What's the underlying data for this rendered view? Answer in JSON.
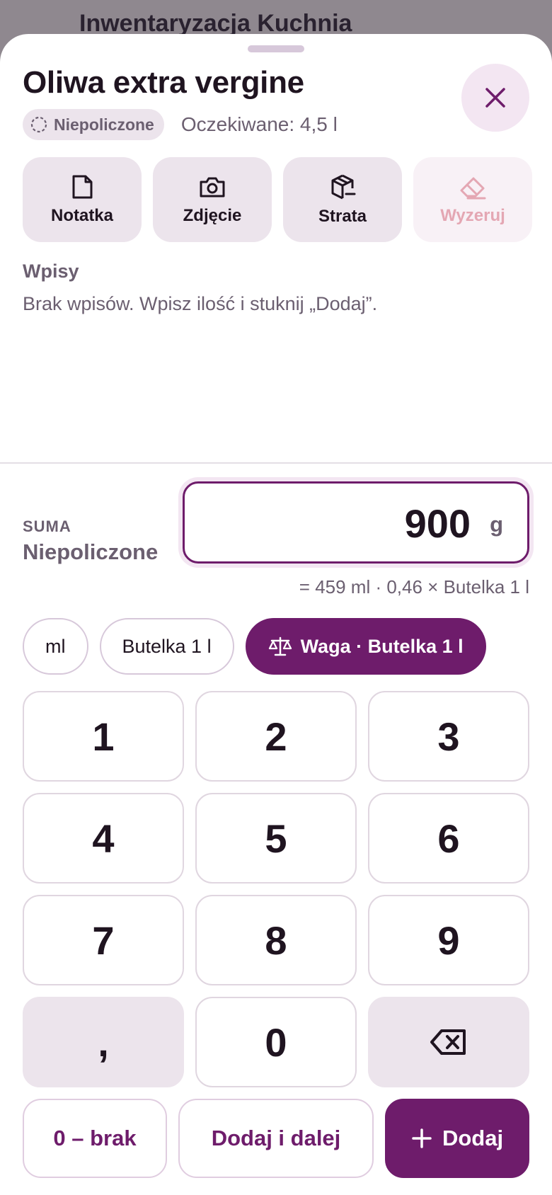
{
  "background": {
    "title": "Inwentaryzacja Kuchnia"
  },
  "product": {
    "title": "Oliwa extra vergine",
    "status": "Niepoliczone",
    "expected": "Oczekiwane: 4,5 l"
  },
  "actions": [
    {
      "label": "Notatka",
      "icon": "note-icon"
    },
    {
      "label": "Zdjęcie",
      "icon": "camera-icon"
    },
    {
      "label": "Strata",
      "icon": "package-loss-icon"
    },
    {
      "label": "Wyzeruj",
      "icon": "eraser-icon",
      "disabled": true
    }
  ],
  "entries": {
    "heading": "Wpisy",
    "empty": "Brak wpisów. Wpisz ilość i stuknij „Dodaj”."
  },
  "summary": {
    "label": "SUMA",
    "value": "Niepoliczone",
    "amount": "900",
    "unit": "g",
    "conversion": "= 459 ml · 0,46 × Butelka 1 l"
  },
  "units": [
    {
      "label": "ml",
      "active": false
    },
    {
      "label": "Butelka 1 l",
      "active": false
    },
    {
      "label": "Waga · Butelka 1 l",
      "active": true,
      "icon": "scale-icon"
    }
  ],
  "keypad": {
    "keys": [
      "1",
      "2",
      "3",
      "4",
      "5",
      "6",
      "7",
      "8",
      "9",
      ",",
      "0"
    ],
    "backspace_icon": "backspace-icon"
  },
  "buttons": {
    "zero": "0 – brak",
    "add_next": "Dodaj i dalej",
    "add": "Dodaj"
  },
  "colors": {
    "accent": "#6e1c6b",
    "surface": "#ece4ec",
    "muted_text": "#6b5f70",
    "disabled_text": "#e4a7b3"
  }
}
